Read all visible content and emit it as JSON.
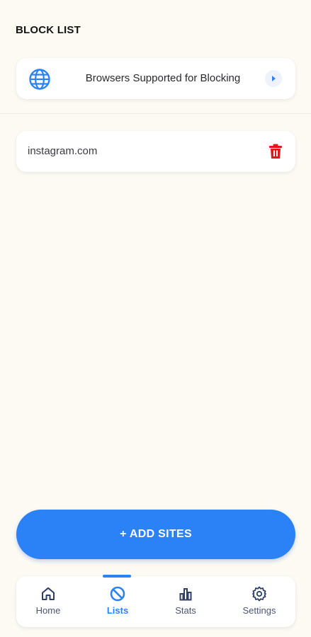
{
  "header": {
    "title": "BLOCK LIST"
  },
  "browsers_card": {
    "label": "Browsers Supported for Blocking",
    "icon": "globe-icon"
  },
  "block_list": [
    {
      "site": "instagram.com"
    }
  ],
  "add_button": {
    "label": "+ ADD SITES"
  },
  "nav": {
    "items": [
      {
        "label": "Home",
        "icon": "home-icon",
        "active": false
      },
      {
        "label": "Lists",
        "icon": "block-icon",
        "active": true
      },
      {
        "label": "Stats",
        "icon": "bar-chart-icon",
        "active": false
      },
      {
        "label": "Settings",
        "icon": "gear-icon",
        "active": false
      }
    ]
  },
  "colors": {
    "accent": "#2a82f6",
    "delete": "#e0171b",
    "background": "#fdfaf4"
  }
}
